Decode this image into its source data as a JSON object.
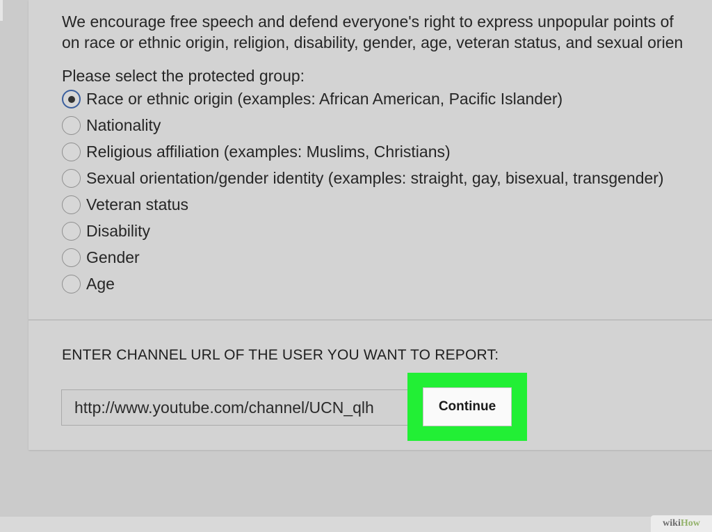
{
  "intro": {
    "line1": "We encourage free speech and defend everyone's right to express unpopular points of",
    "line2": "on race or ethnic origin, religion, disability, gender, age, veteran status, and sexual orien"
  },
  "form": {
    "select_label": "Please select the protected group:",
    "options": [
      {
        "label": "Race or ethnic origin (examples: African American, Pacific Islander)",
        "checked": true
      },
      {
        "label": "Nationality",
        "checked": false
      },
      {
        "label": "Religious affiliation (examples: Muslims, Christians)",
        "checked": false
      },
      {
        "label": "Sexual orientation/gender identity (examples: straight, gay, bisexual, transgender)",
        "checked": false
      },
      {
        "label": "Veteran status",
        "checked": false
      },
      {
        "label": "Disability",
        "checked": false
      },
      {
        "label": "Gender",
        "checked": false
      },
      {
        "label": "Age",
        "checked": false
      }
    ],
    "channel_label": "ENTER CHANNEL URL OF THE USER YOU WANT TO REPORT:",
    "channel_url_value": "http://www.youtube.com/channel/UCN_qlh",
    "continue_label": "Continue"
  },
  "watermark": {
    "part1": "wiki",
    "part2": "How"
  },
  "colors": {
    "page_background": "#cbcbcb",
    "card_background": "#d3d3d3",
    "highlight": "#22ef35",
    "radio_checked_ring": "#3b5f9e"
  }
}
